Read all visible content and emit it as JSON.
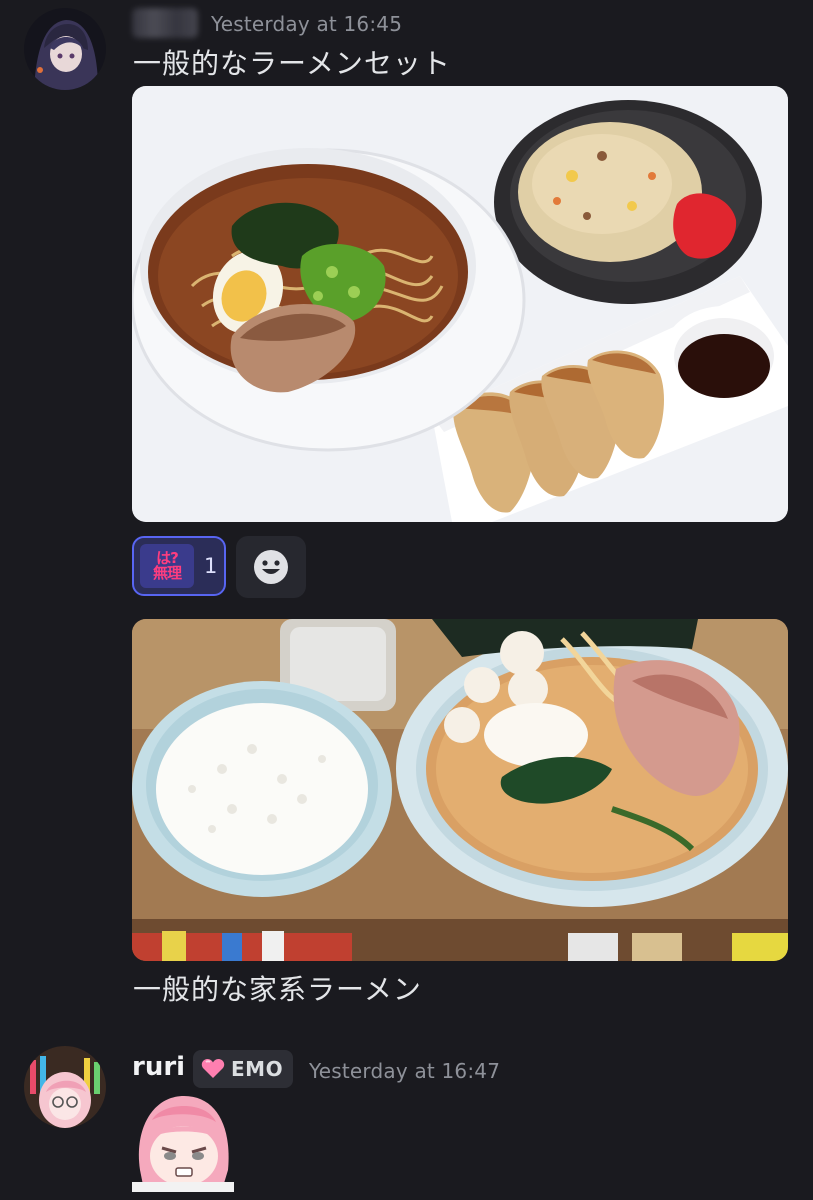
{
  "message1": {
    "author_avatar_icon": "anime-avatar-dark",
    "timestamp": "Yesterday at 16:45",
    "text": "一般的なラーメンセット",
    "attachment_icon": "ramen-set-photo",
    "reaction": {
      "emoji_top": "は?",
      "emoji_bottom": "無理",
      "count": "1"
    },
    "add_reaction_icon": "add-reaction-smiley-icon"
  },
  "message2": {
    "attachment_icon": "iekei-ramen-photo",
    "text": "一般的な家系ラーメン"
  },
  "message3": {
    "author_avatar_icon": "anime-avatar-pink",
    "username": "ruri",
    "tag_icon": "pink-heart-icon",
    "tag_label": "EMO",
    "timestamp": "Yesterday at 16:47",
    "sticker_icon": "angry-pink-hair-sticker"
  }
}
